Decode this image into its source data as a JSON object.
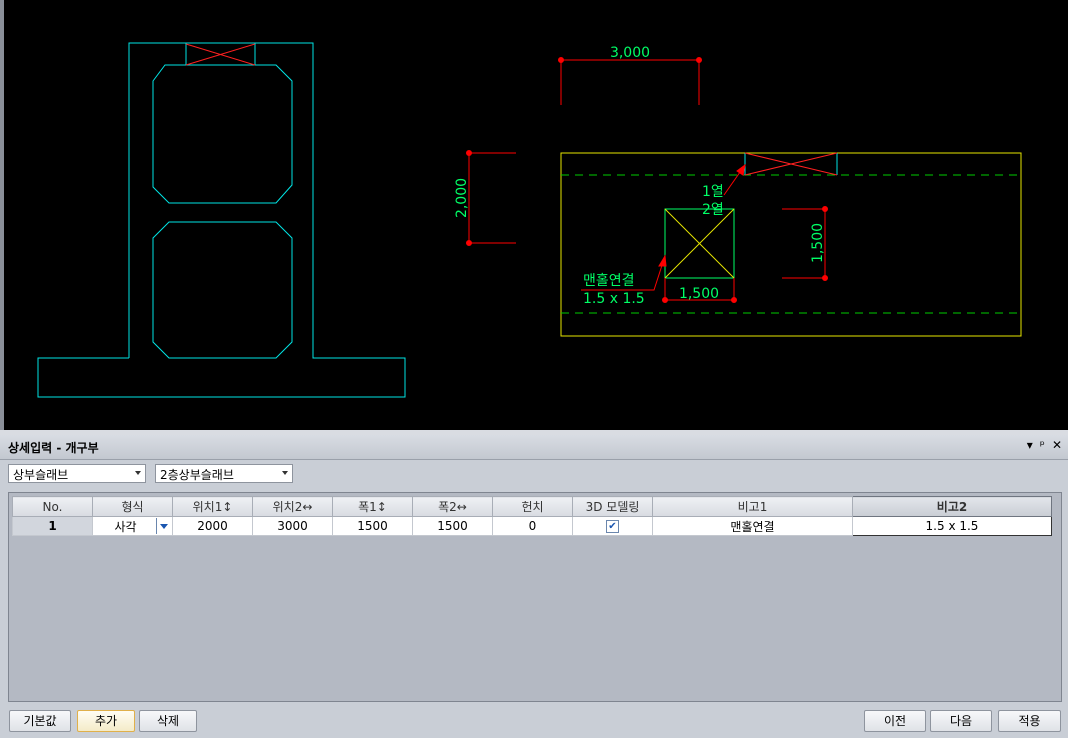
{
  "drawing": {
    "dims": {
      "top_width": "3,000",
      "left_height": "2,000",
      "right_height": "1,500",
      "bottom_width": "1,500"
    },
    "labels": {
      "row_label": "1열",
      "col_label": "2열",
      "remark1": "맨홀연결",
      "remark2": "1.5 x 1.5"
    },
    "colors": {
      "structure": "#00e5e5",
      "slab": "#e6e600",
      "dimension": "#ff0000",
      "text": "#00ff66",
      "dashed": "#00cc00"
    }
  },
  "panel": {
    "title": "상세입력 - 개구부",
    "controls": [
      "▾",
      "ᵖ",
      "✕"
    ],
    "combo1": "상부슬래브",
    "combo2": "2층상부슬래브"
  },
  "table": {
    "headers": [
      "No.",
      "형식",
      "위치1↕",
      "위치2↔",
      "폭1↕",
      "폭2↔",
      "헌치",
      "3D 모델링",
      "비고1",
      "비고2"
    ],
    "rows": [
      {
        "no": "1",
        "type": "사각",
        "pos1": "2000",
        "pos2": "3000",
        "w1": "1500",
        "w2": "1500",
        "haunch": "0",
        "model3d": "✔",
        "remark1": "맨홀연결",
        "remark2": "1.5 x 1.5"
      }
    ]
  },
  "buttons": {
    "default": "기본값",
    "add": "추가",
    "delete": "삭제",
    "prev": "이전",
    "next": "다음",
    "apply": "적용"
  }
}
